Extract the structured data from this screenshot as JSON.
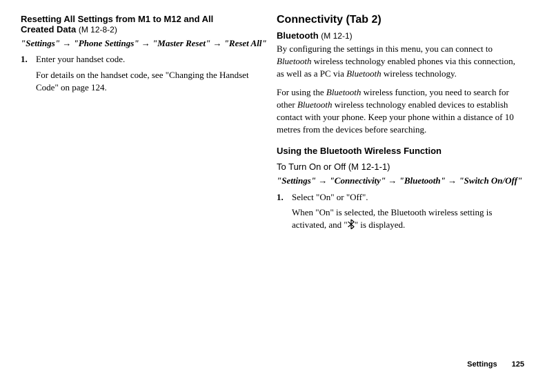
{
  "left": {
    "title_line1": "Resetting All Settings from M1 to M12 and All",
    "title_line2": "Created Data",
    "title_code": "(M 12-8-2)",
    "nav": {
      "p1": "\"Settings\"",
      "p2": "\"Phone Settings\"",
      "p3": "\"Master Reset\"",
      "p4": "\"Reset All\""
    },
    "step1_num": "1.",
    "step1_text": "Enter your handset code.",
    "step1_sub": "For details on the handset code, see \"Changing the Handset Code\" on page 124."
  },
  "right": {
    "connectivity_title": "Connectivity",
    "connectivity_code": "(Tab 2)",
    "bluetooth_title": "Bluetooth",
    "bluetooth_code": "(M 12-1)",
    "para1_a": "By configuring the settings in this menu, you can connect to ",
    "para1_b": "Bluetooth",
    "para1_c": " wireless technology enabled phones via this connection, as well as a PC via ",
    "para1_d": "Bluetooth",
    "para1_e": " wireless technology.",
    "para2_a": "For using the ",
    "para2_b": "Bluetooth",
    "para2_c": " wireless function, you need to search for other ",
    "para2_d": "Bluetooth",
    "para2_e": " wireless technology enabled devices to establish contact with your phone. Keep your phone within a distance of 10 metres from the devices before searching.",
    "using_heading": "Using the Bluetooth Wireless Function",
    "toturn_heading": "To Turn On or Off",
    "toturn_code": "(M 12-1-1)",
    "nav": {
      "p1": "\"Settings\"",
      "p2": "\"Connectivity\"",
      "p3": "\"Bluetooth\"",
      "p4": "\"Switch On/Off\""
    },
    "step1_num": "1.",
    "step1_text": "Select \"On\" or \"Off\".",
    "step1_sub_a": "When \"On\" is selected, the ",
    "step1_sub_b": "Bluetooth",
    "step1_sub_c": " wireless setting is activated, and \"",
    "step1_sub_d": "\" is displayed."
  },
  "footer": {
    "section": "Settings",
    "page": "125"
  },
  "arrow": "→"
}
